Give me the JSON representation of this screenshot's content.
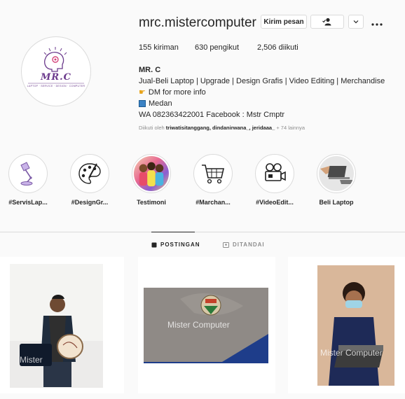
{
  "profile": {
    "username": "mrc.mistercomputer",
    "avatar_logo_text": "MR.C",
    "avatar_logo_sub": "LAPTOP · SERVICE · DESIGN · COMPUTER",
    "buttons": {
      "message": "Kirim pesan"
    },
    "stats": {
      "posts": "155 kiriman",
      "followers": "630 pengikut",
      "following": "2,506 diikuti"
    },
    "bio": {
      "name": "MR. C",
      "line1": "Jual-Beli Laptop | Upgrade | Design Grafis | Video Editing | Merchandise",
      "line2": "DM for more info",
      "line3": "Medan",
      "line4": "WA 082363422001 Facebook : Mstr Cmptr"
    },
    "followed_by": {
      "prefix": "Diikuti oleh",
      "names": "triwatisitanggang, dindanirwana_, jeridaaa_",
      "suffix": "+ 74 lainnya"
    }
  },
  "highlights": [
    {
      "label": "#ServisLap...",
      "icon": "desk-lamp-icon"
    },
    {
      "label": "#DesignGr...",
      "icon": "palette-icon"
    },
    {
      "label": "Testimoni",
      "icon": "people-photo"
    },
    {
      "label": "#Marchan...",
      "icon": "shopping-cart-icon"
    },
    {
      "label": "#VideoEdit...",
      "icon": "film-camera-icon"
    },
    {
      "label": "Beli Laptop",
      "icon": "laptop-photo"
    }
  ],
  "tabs": {
    "posts": "POSTINGAN",
    "tagged": "DITANDAI"
  },
  "posts": [
    {
      "watermark": "Mister"
    },
    {
      "watermark": "Mister Computer"
    },
    {
      "watermark": "Mister Computer"
    }
  ],
  "colors": {
    "brand_purple": "#6b3a8c",
    "border": "#dbdbdb",
    "background": "#fafafa"
  }
}
